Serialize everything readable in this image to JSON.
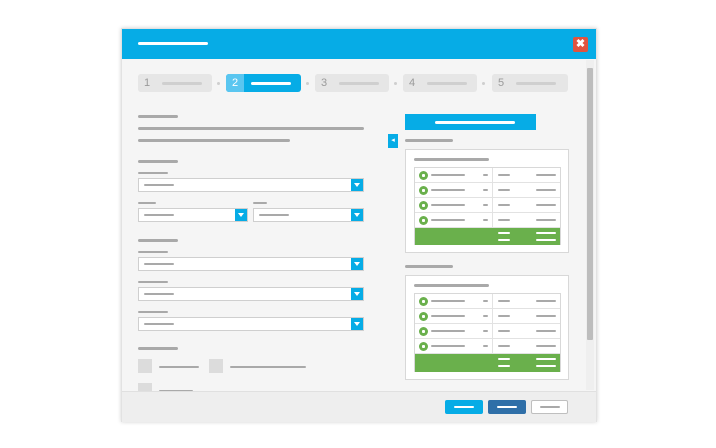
{
  "colors": {
    "accent": "#06ace6",
    "close": "#e0533f",
    "green": "#6ab04c",
    "primary_dark": "#2f6fa8"
  },
  "dialog": {
    "close_label": "✖"
  },
  "steps": [
    "1",
    "2",
    "3",
    "4",
    "5"
  ],
  "sidebar": {
    "collapse_label": "◂"
  }
}
